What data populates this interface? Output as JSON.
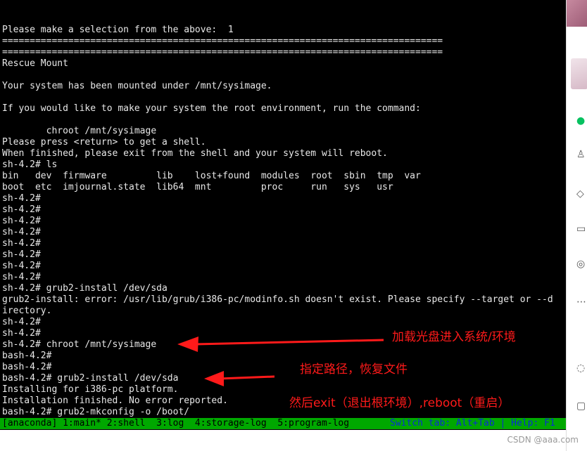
{
  "terminal": {
    "lines": [
      "Please make a selection from the above:  1",
      "================================================================================",
      "================================================================================",
      "Rescue Mount",
      "",
      "Your system has been mounted under /mnt/sysimage.",
      "",
      "If you would like to make your system the root environment, run the command:",
      "",
      "        chroot /mnt/sysimage",
      "Please press <return> to get a shell.",
      "When finished, please exit from the shell and your system will reboot.",
      "sh-4.2# ls",
      "bin   dev  firmware         lib    lost+found  modules  root  sbin  tmp  var",
      "boot  etc  imjournal.state  lib64  mnt         proc     run   sys   usr",
      "sh-4.2#",
      "sh-4.2#",
      "sh-4.2#",
      "sh-4.2#",
      "sh-4.2#",
      "sh-4.2#",
      "sh-4.2#",
      "sh-4.2#",
      "sh-4.2# grub2-install /dev/sda",
      "grub2-install: error: /usr/lib/grub/i386-pc/modinfo.sh doesn't exist. Please specify --target or --d",
      "irectory.",
      "sh-4.2#",
      "sh-4.2#",
      "sh-4.2# chroot /mnt/sysimage",
      "bash-4.2#",
      "bash-4.2#",
      "bash-4.2# grub2-install /dev/sda",
      "Installing for i386-pc platform.",
      "Installation finished. No error reported.",
      "bash-4.2# grub2-mkconfig -o /boot/"
    ]
  },
  "status_bar": {
    "tabs": "[anaconda] 1:main* 2:shell  3:log  4:storage-log  5:program-log",
    "help": "Switch tab: Alt+Tab | Help: F1"
  },
  "annotations": {
    "mount_note": "加载光盘进入系统/环境",
    "path_note": "指定路径，恢复文件",
    "exit_note": "然后exit（退出根环境）,reboot（重启）"
  },
  "watermark": "CSDN @aaa.com",
  "colors": {
    "terminal_bg": "#000000",
    "terminal_text": "#e8e8e8",
    "status_bg": "#00a800",
    "status_help": "#0a2bd8",
    "annotation": "#ff1a1a"
  },
  "side_panel": {
    "icons": [
      "chat-icon",
      "contacts-icon",
      "box-icon",
      "folder-icon",
      "moments-icon",
      "more-icon",
      "mini-program-icon",
      "window-icon"
    ]
  }
}
